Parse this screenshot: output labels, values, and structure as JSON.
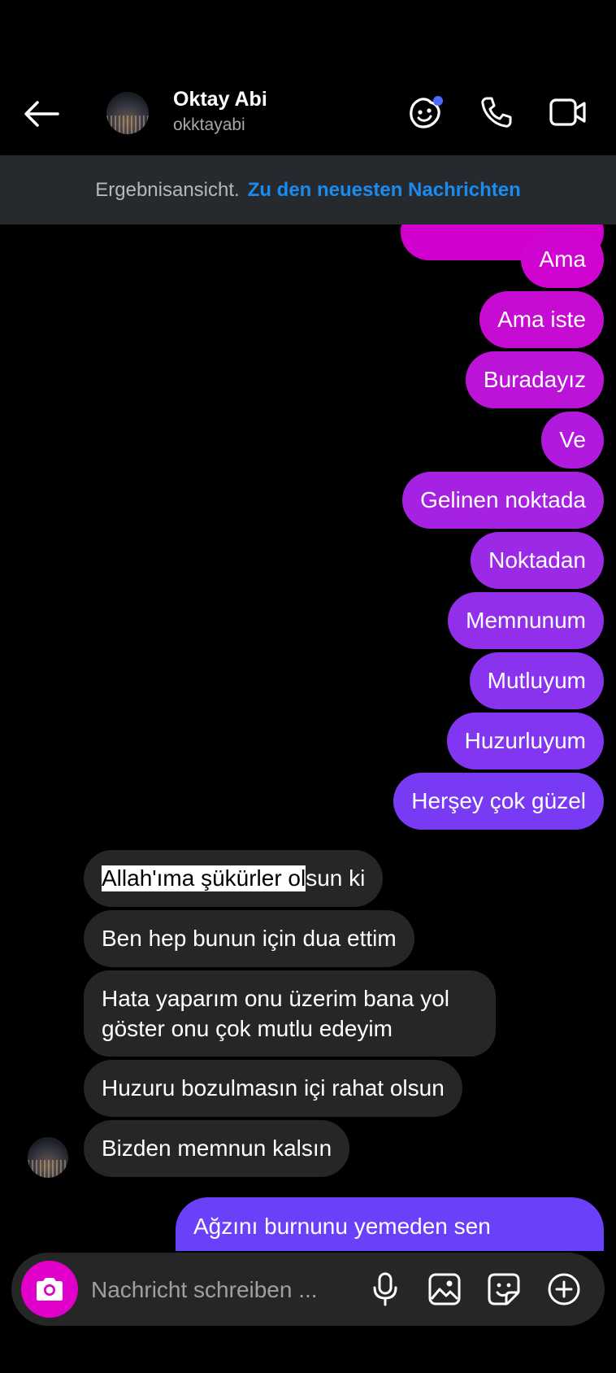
{
  "header": {
    "contact_name": "Oktay Abi",
    "contact_handle": "okktayabi"
  },
  "banner": {
    "status_text": "Ergebnisansicht.",
    "link_text": "Zu den neuesten Nachrichten"
  },
  "messages": {
    "outgoing": [
      "Ama",
      "Ama iste",
      "Buradayız",
      "Ve",
      "Gelinen noktada",
      "Noktadan",
      "Memnunum",
      "Mutluyum",
      "Huzurluyum",
      "Herşey çok güzel"
    ],
    "incoming": [
      {
        "highlighted": "Allah'ıma şükürler ol",
        "rest": "sun ki"
      },
      {
        "text": "Ben hep bunun için dua ettim"
      },
      {
        "text": "Hata yaparım onu üzerim bana yol göster onu çok mutlu edeyim"
      },
      {
        "text": "Huzuru bozulmasın içi rahat olsun"
      },
      {
        "text": "Bizden memnun kalsın"
      }
    ],
    "last_outgoing": "Ağzını burnunu yemeden sen"
  },
  "composer": {
    "placeholder": "Nachricht schreiben ..."
  },
  "icons": {
    "back": "back-arrow-icon",
    "effects": "effects-face-icon",
    "call": "phone-icon",
    "video": "video-camera-icon",
    "camera": "camera-icon",
    "mic": "microphone-icon",
    "gallery": "image-icon",
    "sticker": "sticker-icon",
    "plus": "plus-circle-icon"
  },
  "colors": {
    "background": "#000000",
    "banner_bg": "#262a2f",
    "link": "#1a8cf0",
    "incoming_bubble": "#262626",
    "camera_button": "#e000c9",
    "notification_dot": "#4f6bff",
    "gradient_top": "#d100cf",
    "gradient_mid": "#a626e8",
    "gradient_bottom": "#6a40f8"
  }
}
